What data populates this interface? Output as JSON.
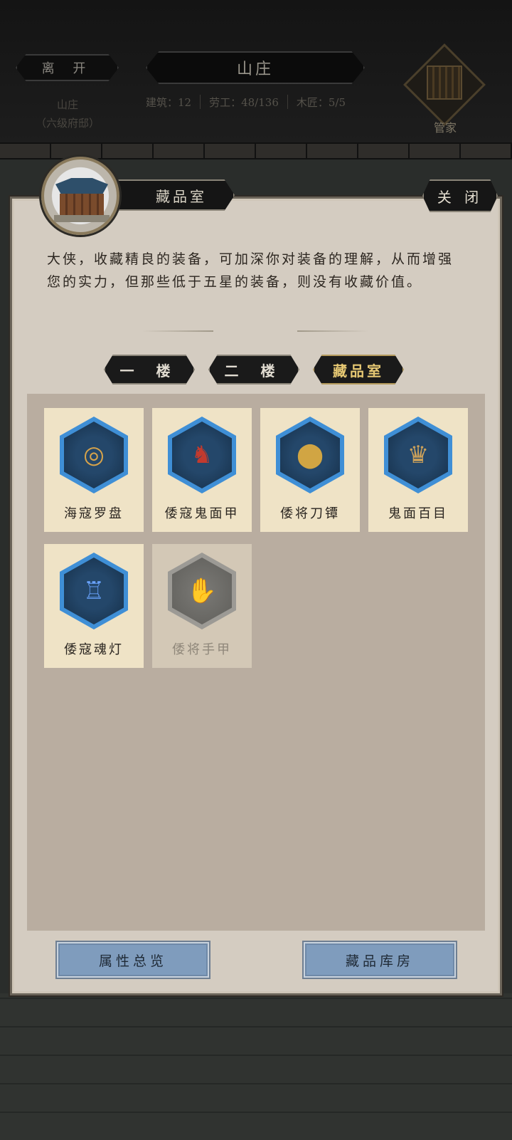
{
  "header": {
    "leave_label": "离 开",
    "title": "山庄",
    "location_line1": "山庄",
    "location_line2": "（六级府邸）",
    "stats": [
      {
        "label": "建筑：12"
      },
      {
        "label": "劳工：48/136"
      },
      {
        "label": "木匠：5/5"
      }
    ],
    "steward_label": "管家"
  },
  "modal": {
    "room_title": "藏品室",
    "close_label": "关 闭",
    "description": "大侠，收藏精良的装备，可加深你对装备的理解，从而增强您的实力，但那些低于五星的装备，则没有收藏价值。",
    "tabs": [
      {
        "label": "一 楼",
        "active": false
      },
      {
        "label": "二 楼",
        "active": false
      },
      {
        "label": "藏品室",
        "active": true
      }
    ],
    "items": [
      {
        "name": "海寇罗盘",
        "icon": "compass-icon",
        "unlocked": true
      },
      {
        "name": "倭寇鬼面甲",
        "icon": "oni-mask-icon",
        "unlocked": true
      },
      {
        "name": "倭将刀镡",
        "icon": "sword-guard-icon",
        "unlocked": true
      },
      {
        "name": "鬼面百目",
        "icon": "demon-mask-icon",
        "unlocked": true
      },
      {
        "name": "倭寇魂灯",
        "icon": "lantern-icon",
        "unlocked": true
      },
      {
        "name": "倭将手甲",
        "icon": "gauntlet-icon",
        "unlocked": false
      }
    ],
    "footer": {
      "attributes_label": "属性总览",
      "storage_label": "藏品库房"
    }
  },
  "colors": {
    "panel_bg": "#d4ccc1",
    "card_bg": "#efe3c6",
    "hex_border": "#3f8fd6",
    "active_tab_text": "#e6c873",
    "bottom_button": "#7f9cbd"
  }
}
